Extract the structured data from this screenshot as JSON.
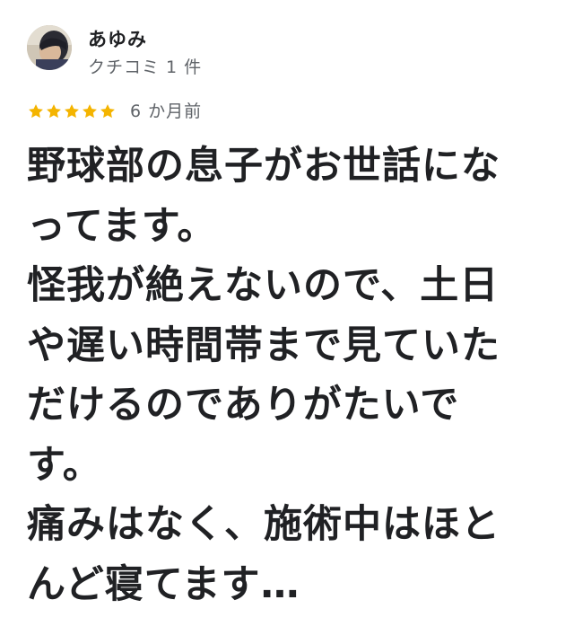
{
  "reviewer": {
    "name": "あゆみ",
    "meta": "クチコミ 1 件"
  },
  "rating": {
    "stars": 5,
    "max": 5,
    "star_color": "#f4b400",
    "time": "6 か月前"
  },
  "review": {
    "lines": [
      "野球部の息子がお世話にな",
      "ってます。",
      "怪我が絶えないので、土日",
      "や遅い時間帯まで見ていた",
      "だけるのでありがたいで",
      "す。",
      "痛みはなく、施術中はほと",
      "んど寝てます…"
    ]
  }
}
